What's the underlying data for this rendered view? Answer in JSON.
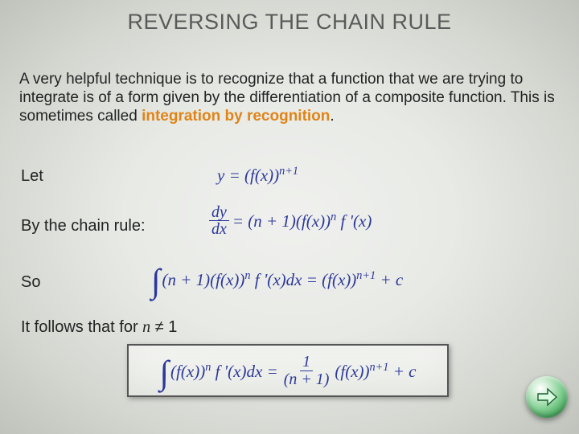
{
  "title": "REVERSING THE CHAIN RULE",
  "paragraph": {
    "pre": "A very helpful technique is to recognize that a function that we are trying to integrate is of a form given by the differentiation of a composite function. This is sometimes called ",
    "highlight": "integration by recognition",
    "post": "."
  },
  "labels": {
    "let": "Let",
    "by": "By the chain rule:",
    "so": "So",
    "follows_pre": "It follows that for ",
    "follows_n": "n",
    "follows_post": " ≠ 1"
  },
  "math": {
    "eq1_left": "y = (f(",
    "eq1_mid": "x",
    "eq1_right": "))",
    "eq1_exp": "n+1",
    "eq2_frac_num": "dy",
    "eq2_frac_den": "dx",
    "eq2_a": " = (",
    "eq2_b": "n",
    "eq2_c": " + 1)(f(",
    "eq2_d": "x",
    "eq2_e": "))",
    "eq2_exp": "n",
    "eq2_f": " f '(",
    "eq2_g": "x",
    "eq2_h": ")",
    "eq3_a": "(",
    "eq3_b": "n",
    "eq3_c": " + 1)(f(",
    "eq3_d": "x",
    "eq3_e": "))",
    "eq3_exp": "n",
    "eq3_f": " f '(",
    "eq3_g": "x",
    "eq3_h": ")",
    "eq3_i": "dx",
    "eq3_j": " = (f(",
    "eq3_k": "x",
    "eq3_l": "))",
    "eq3_exp2": "n+1",
    "eq3_m": " + c",
    "eq4_a": "(f(",
    "eq4_b": "x",
    "eq4_c": "))",
    "eq4_exp": "n",
    "eq4_d": " f '(",
    "eq4_e": "x",
    "eq4_f": ")",
    "eq4_g": "dx",
    "eq4_h": " = ",
    "eq4_frac_num": "1",
    "eq4_frac_den_a": "(",
    "eq4_frac_den_b": "n",
    "eq4_frac_den_c": " + 1)",
    "eq4_i": "(f(",
    "eq4_j": "x",
    "eq4_k": "))",
    "eq4_exp2": "n+1",
    "eq4_l": " + c"
  },
  "nav": {
    "next": "next"
  }
}
